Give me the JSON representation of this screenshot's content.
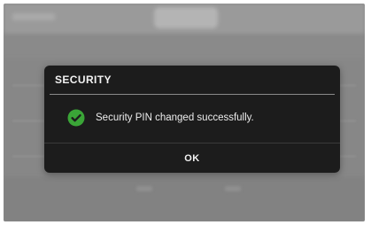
{
  "dialog": {
    "title": "SECURITY",
    "message": "Security PIN changed successfully.",
    "ok_label": "OK",
    "icon": "check-circle-icon"
  },
  "colors": {
    "dialog_background": "#1c1c1c",
    "dimmed_background": "#8a8a8a",
    "success_green": "#3aa537",
    "text": "#f2f2f2"
  }
}
